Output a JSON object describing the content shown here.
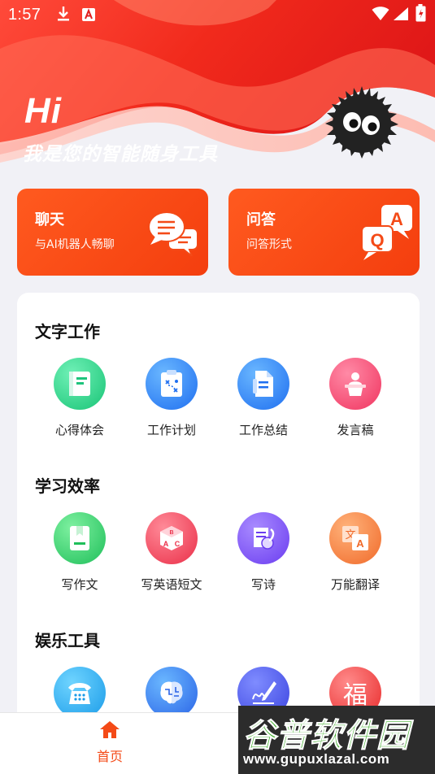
{
  "status_bar": {
    "time": "1:57"
  },
  "hero": {
    "greeting": "Hi",
    "slogan": "我是您的智能随身工具"
  },
  "feature_cards": [
    {
      "title": "聊天",
      "subtitle": "与AI机器人畅聊",
      "icon": "chat-bubbles-icon"
    },
    {
      "title": "问答",
      "subtitle": "问答形式",
      "icon": "qa-bubbles-icon"
    }
  ],
  "sections": [
    {
      "title": "文字工作",
      "items": [
        {
          "label": "心得体会",
          "icon": "book-icon"
        },
        {
          "label": "工作计划",
          "icon": "clipboard-plan-icon"
        },
        {
          "label": "工作总结",
          "icon": "document-summary-icon"
        },
        {
          "label": "发言稿",
          "icon": "podium-speaker-icon"
        }
      ]
    },
    {
      "title": "学习效率",
      "items": [
        {
          "label": "写作文",
          "icon": "notebook-icon"
        },
        {
          "label": "写英语短文",
          "icon": "abc-cube-icon"
        },
        {
          "label": "写诗",
          "icon": "poetry-scroll-icon"
        },
        {
          "label": "万能翻译",
          "icon": "translate-icon"
        }
      ]
    },
    {
      "title": "娱乐工具",
      "items": [
        {
          "label": "",
          "icon": "telephone-icon"
        },
        {
          "label": "",
          "icon": "brain-icon"
        },
        {
          "label": "",
          "icon": "signature-pen-icon"
        },
        {
          "label": "福",
          "icon": "fortune-icon"
        }
      ]
    }
  ],
  "tab_bar": {
    "home_label": "首页"
  },
  "watermark": {
    "brand": "谷普软件园",
    "url": "www.gupuxlazal.com"
  },
  "colors": {
    "accent": "#f44a17",
    "card_orange": "#ff5a1f",
    "page_bg": "#f1f1f6"
  }
}
